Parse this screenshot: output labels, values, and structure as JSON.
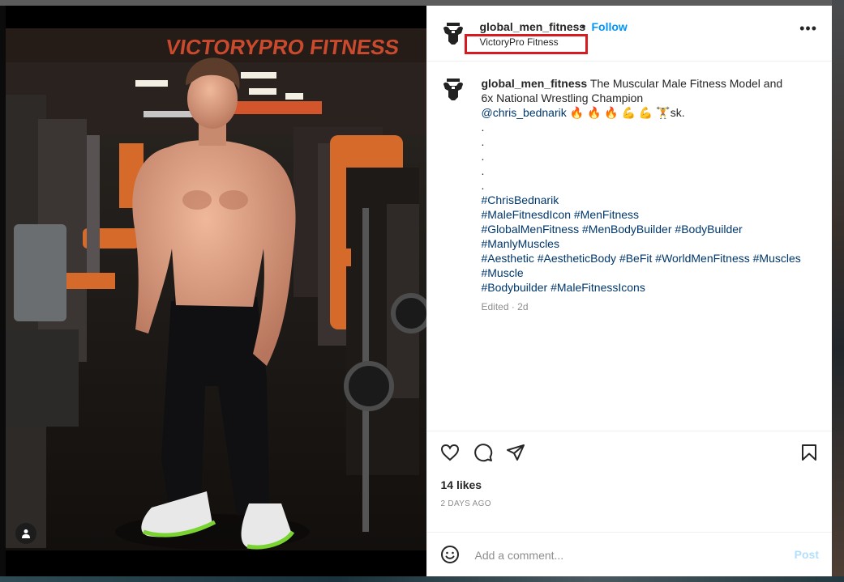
{
  "header": {
    "username": "global_men_fitness",
    "separator": "•",
    "follow_label": "Follow",
    "location": "VictoryPro Fitness",
    "more_icon": "more-horizontal-icon"
  },
  "caption": {
    "username": "global_men_fitness",
    "text_line1": "The Muscular Male Fitness Model and",
    "text_line2": "6x National Wrestling Champion",
    "mention": "@chris_bednarik",
    "emojis": "🔥 🔥 🔥 💪 💪 🏋️",
    "suffix": "sk.",
    "dots": [
      ".",
      ".",
      ".",
      ".",
      "."
    ],
    "hashtags": {
      "h1": "#ChrisBednarik",
      "h2": "#MaleFitnesdIcon",
      "h3": "#MenFitness",
      "h4": "#GlobalMenFitness",
      "h5": "#MenBodyBuilder",
      "h6": "#BodyBuilder",
      "h7": "#ManlyMuscles",
      "h8": "#Aesthetic",
      "h9": "#AestheticBody",
      "h10": "#BeFit",
      "h11": "#WorldMenFitness",
      "h12": "#Muscles",
      "h13": "#Muscle",
      "h14": "#Bodybuilder",
      "h15": "#MaleFitnessIcons"
    },
    "edited": "Edited · 2d"
  },
  "media": {
    "gym_sign": "VICTORYPRO FITNESS",
    "tag_icon": "user-tag-icon"
  },
  "actions": {
    "like_icon": "heart-icon",
    "comment_icon": "comment-icon",
    "share_icon": "send-icon",
    "save_icon": "bookmark-icon"
  },
  "stats": {
    "likes": "14 likes",
    "time": "2 DAYS AGO"
  },
  "comment_box": {
    "placeholder": "Add a comment...",
    "post_label": "Post",
    "emoji_icon": "smiley-icon"
  },
  "colors": {
    "follow": "#0095f6",
    "hashtag": "#00376b",
    "highlight_box": "#d71920",
    "post_disabled": "#b2dffc"
  }
}
